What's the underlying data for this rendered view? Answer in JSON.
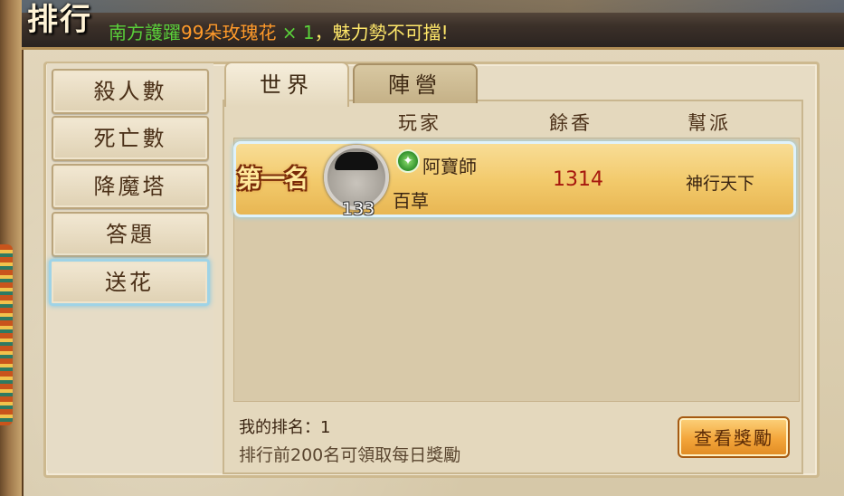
{
  "window": {
    "title": "排行",
    "marquee": {
      "prefix": "南方護躍",
      "highlight": "99朵玫瑰花",
      "mult": " × 1",
      "suffix": "，魅力勢不可擋!"
    }
  },
  "sidebar": {
    "items": [
      {
        "label": "殺人數",
        "active": false
      },
      {
        "label": "死亡數",
        "active": false
      },
      {
        "label": "降魔塔",
        "active": false
      },
      {
        "label": "答題",
        "active": false
      },
      {
        "label": "送花",
        "active": true
      }
    ]
  },
  "tabs": [
    {
      "label": "世界",
      "active": true
    },
    {
      "label": "陣營",
      "active": false
    }
  ],
  "columns": [
    "玩家",
    "餘香",
    "幫派"
  ],
  "ranking": [
    {
      "rank_label": "第一名",
      "level": "133",
      "school_icon": "school-emblem-icon",
      "name_line1": "阿寶師",
      "name_line2": "百草",
      "score": "1314",
      "guild": "神行天下"
    }
  ],
  "footer": {
    "my_rank": "我的排名：1",
    "hint": "排行前200名可領取每日獎勵",
    "reward_button": "查看獎勵"
  },
  "colors": {
    "score": "#a6180e",
    "highlight_row": "#f2c96a",
    "active_outline": "#9fd3e6"
  }
}
